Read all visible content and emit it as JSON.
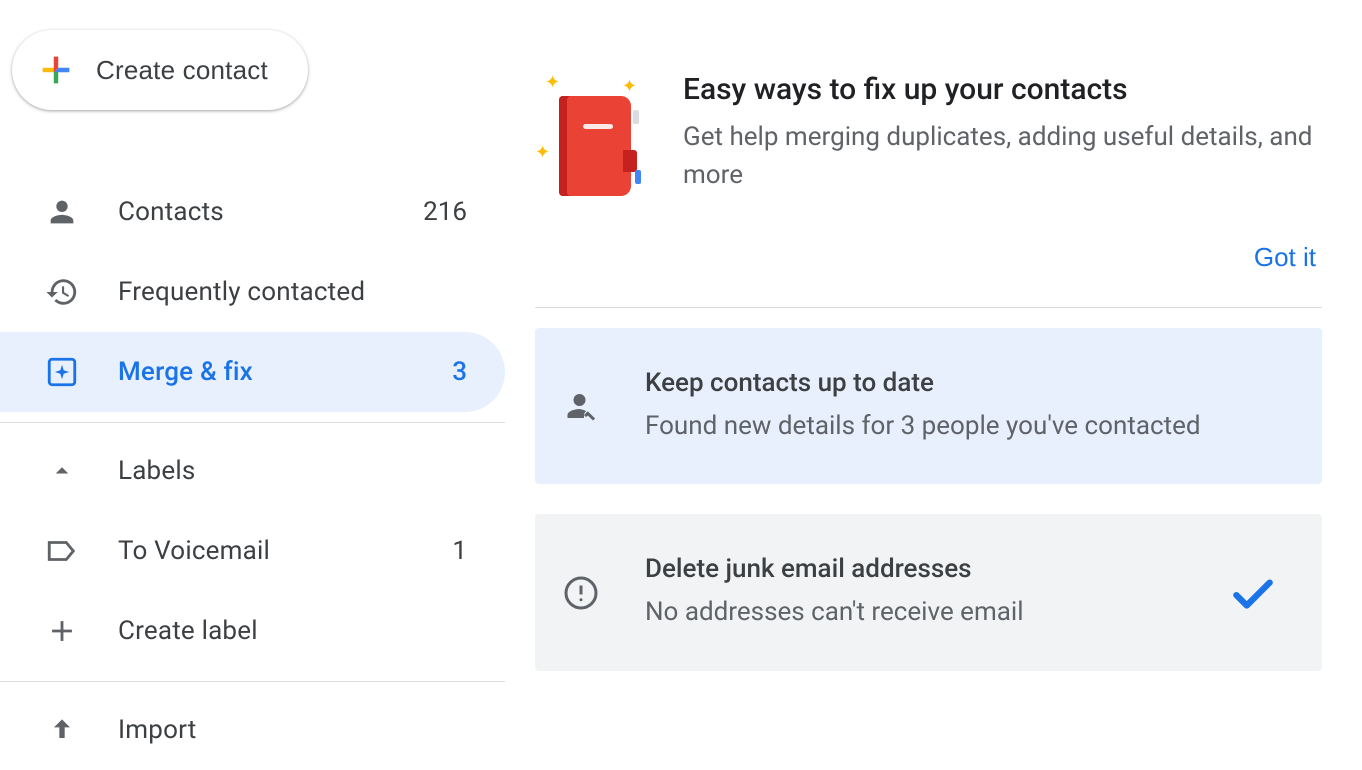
{
  "create_button": {
    "label": "Create contact"
  },
  "sidebar": {
    "items": [
      {
        "label": "Contacts",
        "count": "216"
      },
      {
        "label": "Frequently contacted",
        "count": ""
      },
      {
        "label": "Merge & fix",
        "count": "3"
      }
    ],
    "labels_header": "Labels",
    "labels": [
      {
        "label": "To Voicemail",
        "count": "1"
      }
    ],
    "create_label": "Create label",
    "import": "Import"
  },
  "hero": {
    "title": "Easy ways to fix up your contacts",
    "subtitle": "Get help merging duplicates, adding useful details, and more"
  },
  "got_it": "Got it",
  "cards": [
    {
      "title": "Keep contacts up to date",
      "subtitle": "Found new details for 3 people you've contacted"
    },
    {
      "title": "Delete junk email addresses",
      "subtitle": "No addresses can't receive email"
    }
  ]
}
